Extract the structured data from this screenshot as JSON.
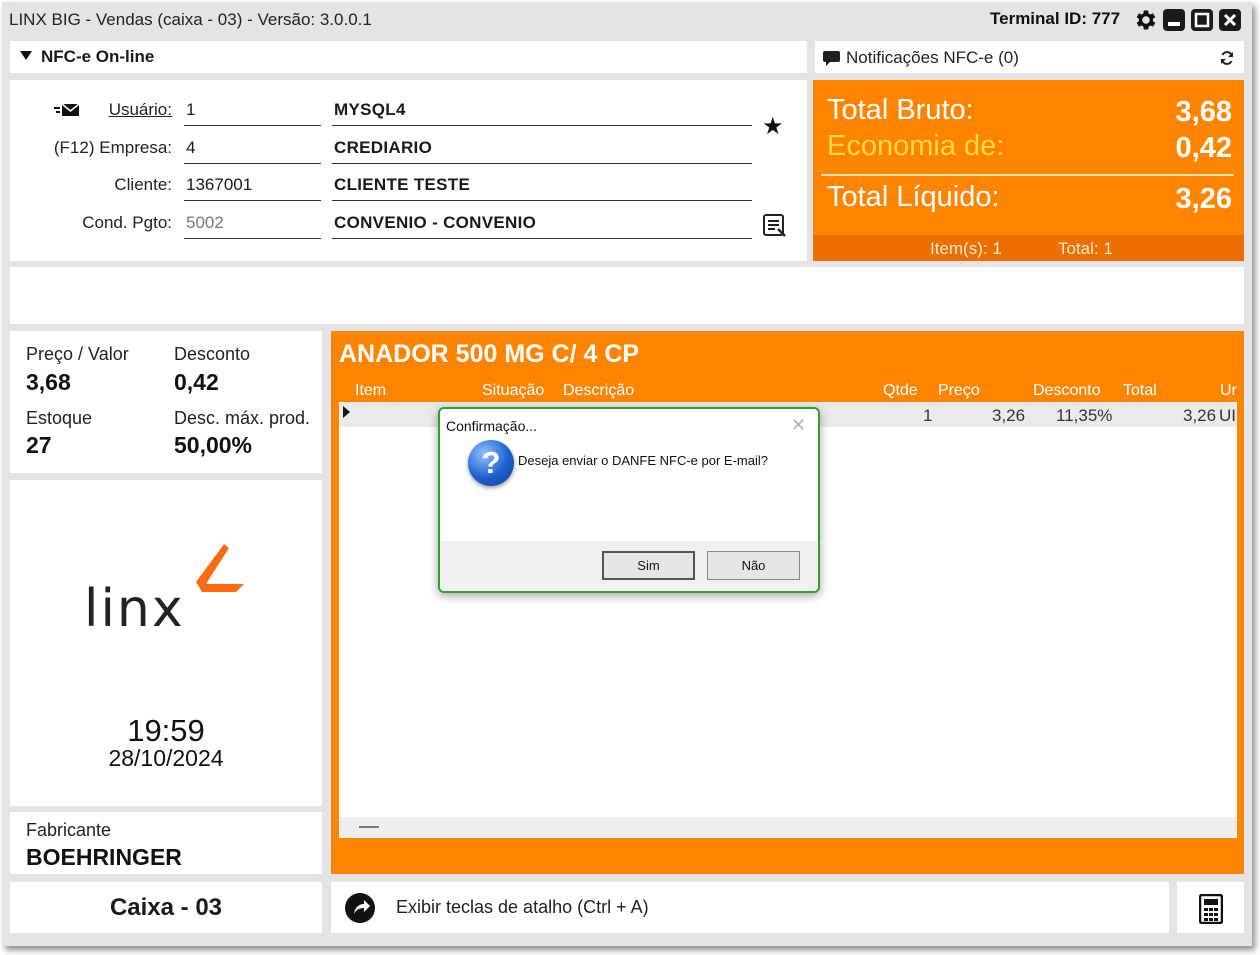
{
  "window": {
    "title": "LINX BIG - Vendas (caixa - 03) - Versão: 3.0.0.1",
    "terminal": "Terminal ID: 777"
  },
  "nfce": {
    "label": "NFC-e On-line"
  },
  "notifications": {
    "label": "Notificações NFC-e (0)"
  },
  "form": {
    "usuario": {
      "label": "Usuário:",
      "code": "1",
      "desc": "MYSQL4"
    },
    "empresa": {
      "prefix": "(F12)",
      "label": "Empresa:",
      "code": "4",
      "desc": "CREDIARIO"
    },
    "cliente": {
      "label": "Cliente:",
      "code": "1367001",
      "desc": "CLIENTE TESTE"
    },
    "cond_pgto": {
      "label": "Cond. Pgto:",
      "code": "5002",
      "desc": "CONVENIO - CONVENIO"
    }
  },
  "totals": {
    "bruto_label": "Total Bruto:",
    "bruto_value": "3,68",
    "economia_label": "Economia de:",
    "economia_value": "0,42",
    "liquido_label": "Total Líquido:",
    "liquido_value": "3,26",
    "items": "Item(s): 1",
    "total": "Total: 1",
    "colors": {
      "orange": "#ff8400",
      "economia": "#ffd84a"
    }
  },
  "info": {
    "preco_label": "Preço / Valor",
    "preco_value": "3,68",
    "desconto_label": "Desconto",
    "desconto_value": "0,42",
    "estoque_label": "Estoque",
    "estoque_value": "27",
    "descmax_label": "Desc. máx. prod.",
    "descmax_value": "50,00%"
  },
  "logo": {
    "text": "linx"
  },
  "clock": {
    "time": "19:59",
    "date": "28/10/2024"
  },
  "fabricante": {
    "label": "Fabricante",
    "value": "BOEHRINGER"
  },
  "product": {
    "title": "ANADOR 500 MG C/ 4 CP",
    "columns": [
      "Item",
      "Situação",
      "Descrição",
      "Qtde",
      "Preço",
      "Desconto",
      "Total",
      "Ur"
    ],
    "row": {
      "qtde": "1",
      "preco": "3,26",
      "desconto": "11,35%",
      "total": "3,26",
      "unidade": "UI"
    }
  },
  "footer": {
    "caixa": "Caixa - 03",
    "shortcut": "Exibir teclas de atalho (Ctrl + A)"
  },
  "dialog": {
    "title": "Confirmação...",
    "message": "Deseja enviar o DANFE NFC-e por E-mail?",
    "yes": "Sim",
    "no": "Não",
    "border_color": "#2ca12c"
  }
}
